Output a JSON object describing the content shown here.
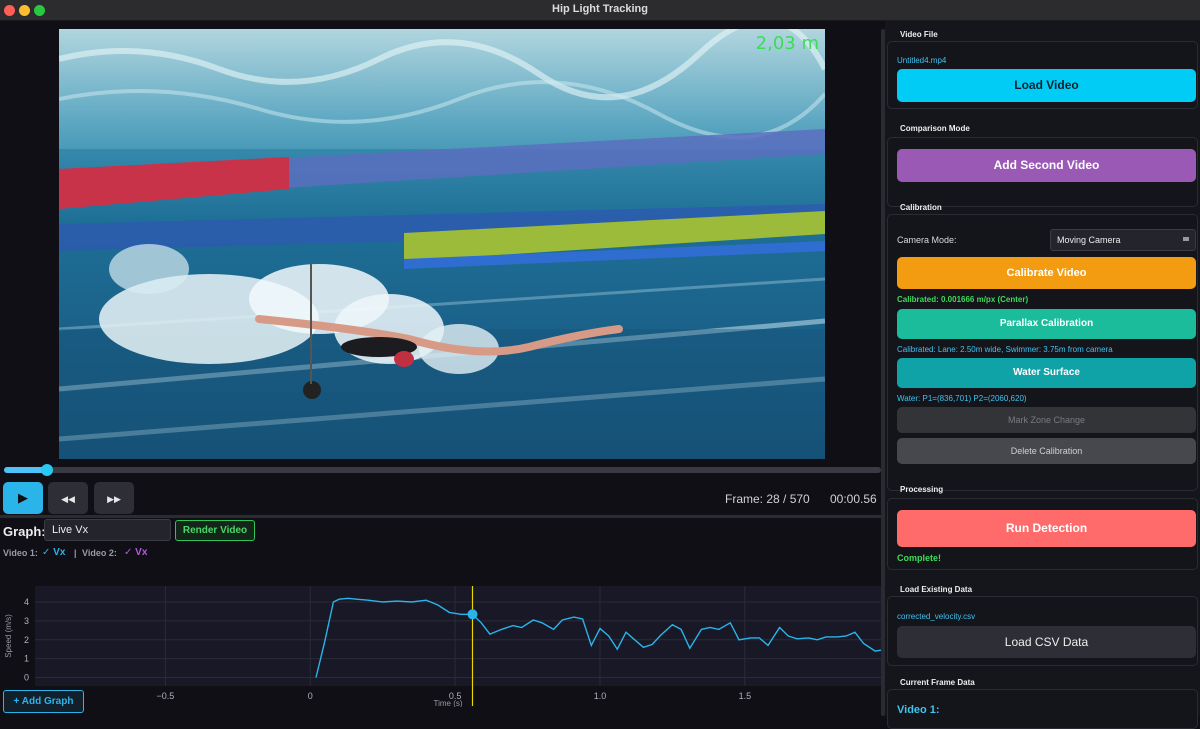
{
  "window": {
    "title": "Hip Light Tracking"
  },
  "video": {
    "distance_label": "2,03 m"
  },
  "playback": {
    "progress": 0.049,
    "play_icon": "▶",
    "rewind_icon": "◀◀",
    "forward_icon": "▶▶",
    "frame_text": "Frame: 28 / 570",
    "time_text": "00:00.56"
  },
  "graph": {
    "label": "Graph:",
    "selected": "Live Vx",
    "render_label": "Render Video",
    "video1_label": "Video 1:",
    "video1_check": "✓ Vx",
    "sep": "|",
    "video2_label": "Video 2:",
    "video2_check": "✓ Vx",
    "add_label": "+ Add Graph"
  },
  "chart_data": {
    "type": "line",
    "xlabel": "Time (s)",
    "ylabel": "Speed (m/s)",
    "xlim": [
      -0.95,
      1.97
    ],
    "ylim": [
      -0.45,
      4.85
    ],
    "xticks": [
      -0.5,
      0,
      0.5,
      1.0,
      1.5
    ],
    "xtick_labels": [
      "−0.5",
      "0",
      "0.5",
      "1.0",
      "1.5"
    ],
    "yticks": [
      0,
      1,
      2,
      3,
      4
    ],
    "cursor_x": 0.56,
    "series": [
      {
        "color": "#2ab4ea",
        "x": [
          0.02,
          0.05,
          0.08,
          0.1,
          0.13,
          0.16,
          0.2,
          0.25,
          0.3,
          0.35,
          0.4,
          0.44,
          0.48,
          0.52,
          0.56,
          0.59,
          0.62,
          0.66,
          0.7,
          0.73,
          0.77,
          0.8,
          0.84,
          0.87,
          0.91,
          0.94,
          0.97,
          1.0,
          1.03,
          1.06,
          1.09,
          1.12,
          1.15,
          1.18,
          1.21,
          1.25,
          1.28,
          1.31,
          1.35,
          1.38,
          1.41,
          1.45,
          1.48,
          1.52,
          1.55,
          1.58,
          1.62,
          1.65,
          1.68,
          1.72,
          1.75,
          1.78,
          1.82,
          1.85,
          1.88,
          1.91,
          1.95,
          1.97
        ],
        "y": [
          0.0,
          1.9,
          4.0,
          4.15,
          4.2,
          4.15,
          4.1,
          4.0,
          4.05,
          4.0,
          4.1,
          3.85,
          3.45,
          3.35,
          3.35,
          2.9,
          2.3,
          2.55,
          2.75,
          2.65,
          3.05,
          2.9,
          2.55,
          3.05,
          3.2,
          3.1,
          1.7,
          2.6,
          2.2,
          1.5,
          2.4,
          2.0,
          1.6,
          1.75,
          2.25,
          2.8,
          2.55,
          1.55,
          2.55,
          2.65,
          2.55,
          2.9,
          2.0,
          2.1,
          2.1,
          1.7,
          2.65,
          2.2,
          2.05,
          2.1,
          2.0,
          2.15,
          2.15,
          2.2,
          2.4,
          1.8,
          1.4,
          1.45
        ]
      }
    ]
  },
  "panel": {
    "video_file": {
      "header": "Video File",
      "filename": "Untitled4.mp4",
      "button": "Load Video",
      "button_color": "#00ccf5"
    },
    "comparison": {
      "header": "Comparison Mode",
      "button": "Add Second Video",
      "button_color": "#9b59b6"
    },
    "calibration": {
      "header": "Calibration",
      "camera_mode_label": "Camera Mode:",
      "camera_mode_value": "Moving Camera",
      "calibrate_button": "Calibrate Video",
      "calibrate_color": "#f39c12",
      "calibrated_status": "Calibrated: 0.001666 m/px (Center)",
      "parallax_button": "Parallax Calibration",
      "parallax_color": "#1abc9c",
      "parallax_status": "Calibrated: Lane: 2.50m wide, Swimmer: 3.75m from camera",
      "water_button": "Water Surface",
      "water_color": "#0fa3a8",
      "water_status": "Water: P1=(836,701)  P2=(2060,620)",
      "zone_button": "Mark Zone Change",
      "delete_button": "Delete Calibration"
    },
    "processing": {
      "header": "Processing",
      "button": "Run Detection",
      "button_color": "#ff6b6b",
      "status": "Complete!"
    },
    "existing": {
      "header": "Load Existing Data",
      "filename": "corrected_velocity.csv",
      "button": "Load CSV Data"
    },
    "current": {
      "header": "Current Frame Data",
      "video_label": "Video 1:"
    }
  }
}
